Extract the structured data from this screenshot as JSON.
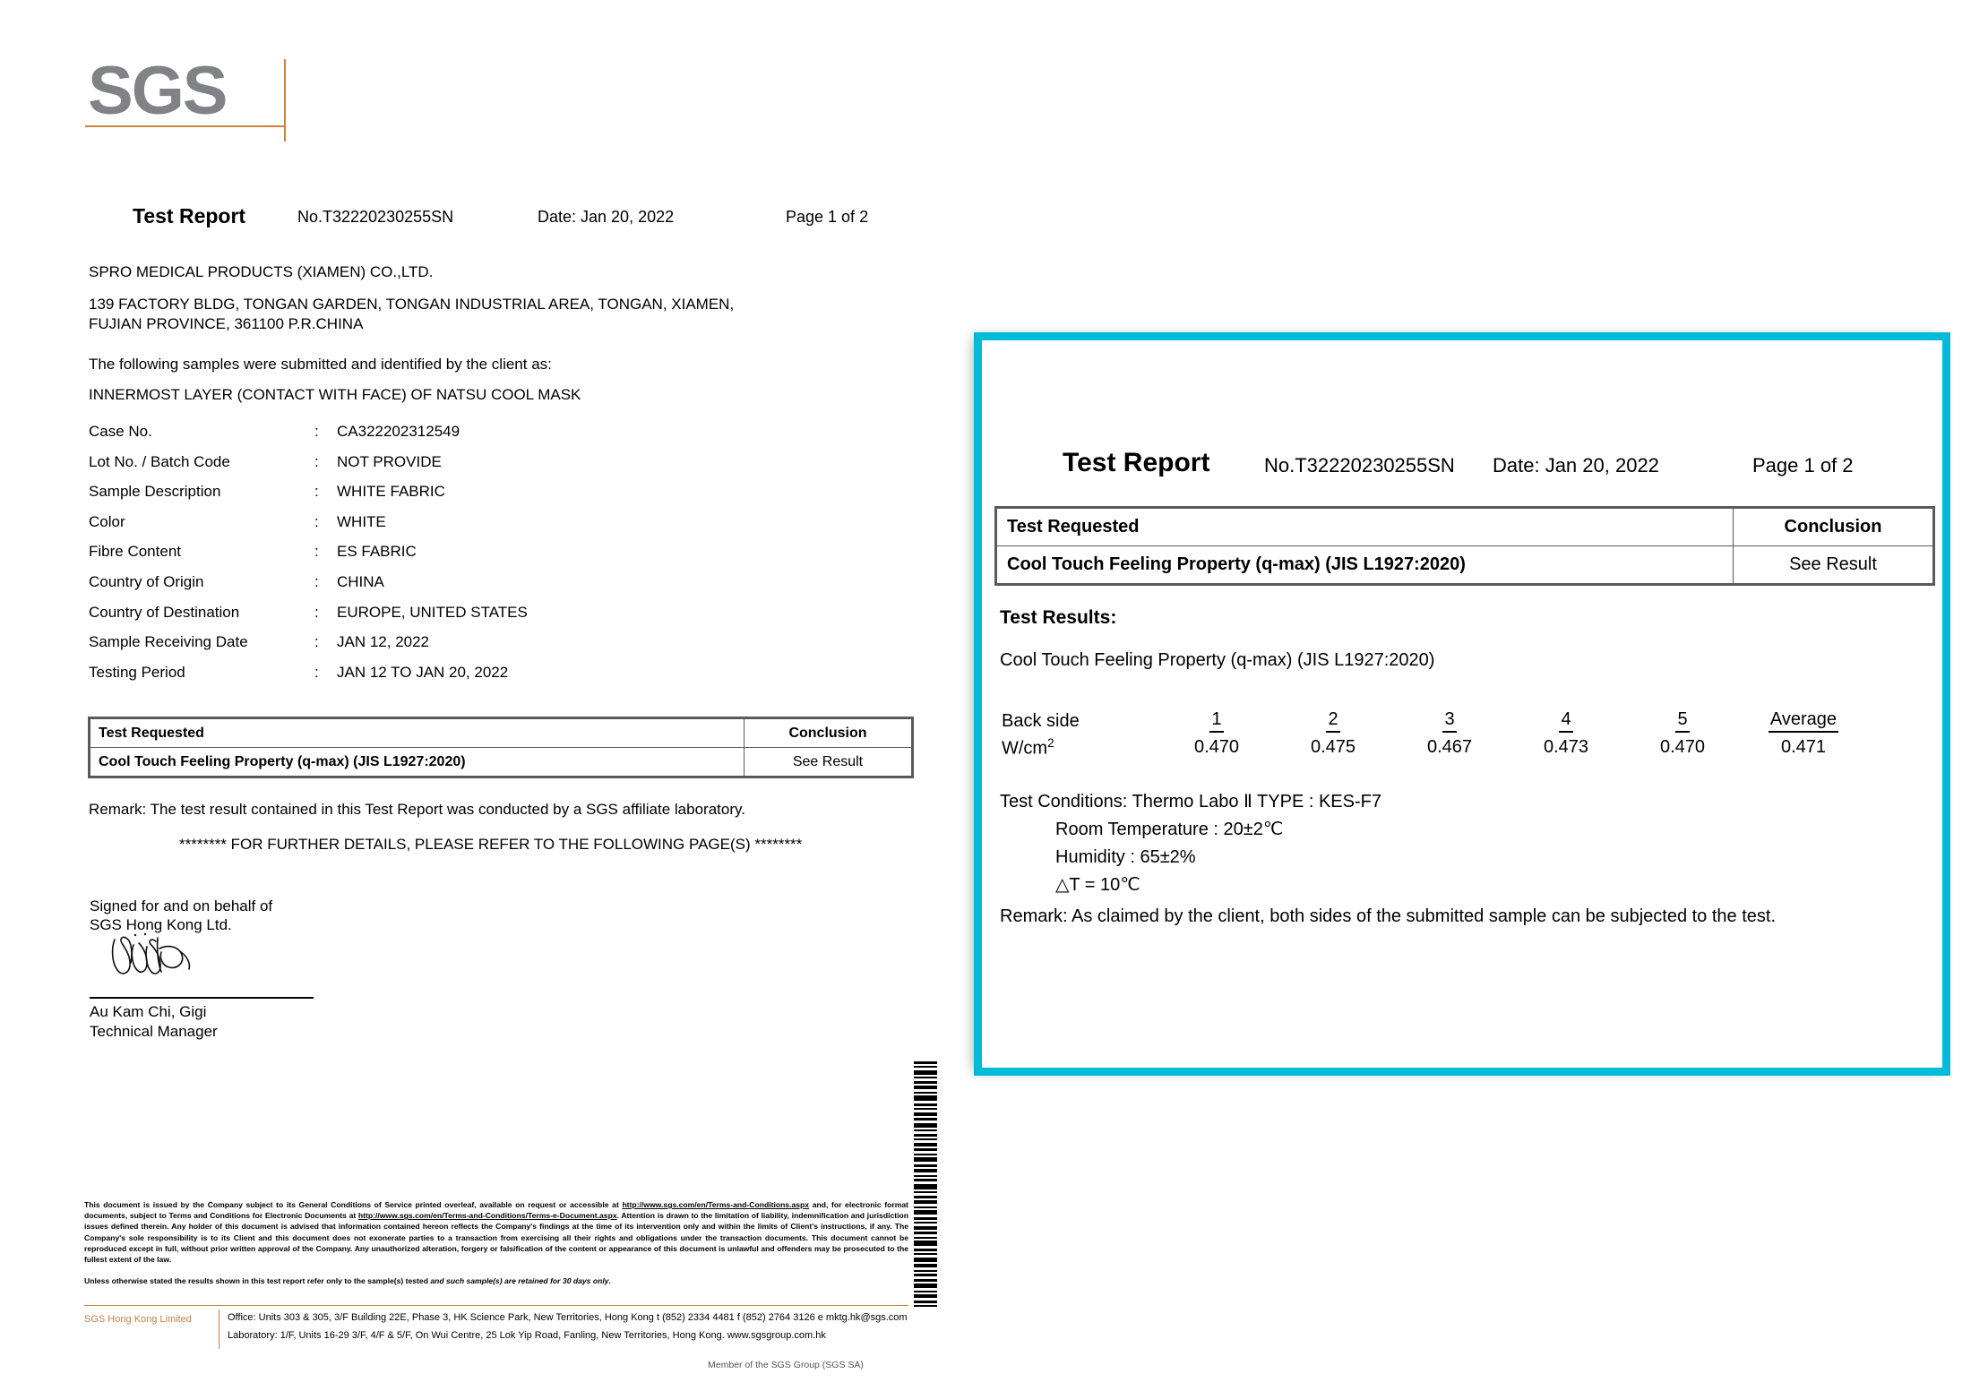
{
  "document": {
    "logo_text": "SGS",
    "header": {
      "title": "Test Report",
      "report_no": "No.T32220230255SN",
      "date": "Date:  Jan 20, 2022",
      "page": "Page 1 of  2"
    },
    "client": {
      "name": "SPRO MEDICAL PRODUCTS (XIAMEN) CO.,LTD.",
      "address_line1": "139 FACTORY BLDG, TONGAN GARDEN, TONGAN INDUSTRIAL AREA, TONGAN, XIAMEN,",
      "address_line2": "FUJIAN PROVINCE, 361100 P.R.CHINA"
    },
    "intro_line": "The following samples were submitted and identified by the client as:",
    "sample_line": "INNERMOST LAYER (CONTACT WITH FACE) OF NATSU COOL MASK",
    "fields": [
      {
        "label": "Case No.",
        "colon": ":",
        "value": "CA322202312549"
      },
      {
        "label": "Lot No. / Batch Code",
        "colon": ":",
        "value": "NOT PROVIDE"
      },
      {
        "label": "Sample Description",
        "colon": ":",
        "value": "WHITE FABRIC"
      },
      {
        "label": "Color",
        "colon": ":",
        "value": "WHITE"
      },
      {
        "label": "Fibre Content",
        "colon": ":",
        "value": "ES FABRIC"
      },
      {
        "label": "Country of Origin",
        "colon": ":",
        "value": "CHINA"
      },
      {
        "label": "Country of Destination",
        "colon": ":",
        "value": "EUROPE, UNITED STATES"
      },
      {
        "label": "Sample Receiving Date",
        "colon": ":",
        "value": "JAN 12, 2022"
      },
      {
        "label": "Testing Period",
        "colon": ":",
        "value": "JAN 12 TO JAN 20, 2022"
      }
    ],
    "test_requested_table": {
      "col_test": "Test Requested",
      "col_conclusion": "Conclusion",
      "row_test": "Cool Touch Feeling Property (q-max) (JIS L1927:2020)",
      "row_conclusion": "See Result"
    },
    "remark": "Remark: The test result contained in this Test Report was conducted by a SGS affiliate laboratory.",
    "further_details": "******** FOR FURTHER DETAILS, PLEASE REFER TO THE FOLLOWING PAGE(S) ********",
    "signature": {
      "line1": "Signed for and on behalf of",
      "line2": "SGS Hong Kong Ltd.",
      "name": "Au Kam Chi, Gigi",
      "title": "Technical Manager"
    },
    "footer": {
      "legal_part1": "This document is issued by the Company subject to its General Conditions of Service printed overleaf, available on request or accessible at ",
      "legal_url1": "http://www.sgs.com/en/Terms-and-Conditions.aspx",
      "legal_part2": " and, for electronic format documents, subject to Terms and Conditions for Electronic Documents at ",
      "legal_url2": "http://www.sgs.com/en/Terms-and-Conditions/Terms-e-Document.aspx",
      "legal_part3": ". Attention is drawn to the limitation of liability, indemnification and jurisdiction issues defined therein. Any holder of this document is advised that information contained hereon reflects the Company's findings at the time of its intervention only and within the limits of Client's instructions, if any. The Company's sole responsibility is to its Client and this document does not exonerate parties to a transaction from exercising all their rights and obligations under the transaction documents. This document cannot be reproduced except in full, without prior written approval of the Company. Any unauthorized alteration, forgery or falsification of the content or appearance of this document is unlawful and offenders may be prosecuted to the fullest extent of the law.",
      "retain_part1": "Unless otherwise stated the results shown in this test report refer only to the sample(s) tested ",
      "retain_italic": "and such sample(s) are retained for 30 days only",
      "retain_part2": ".",
      "company": "SGS Hong Kong Limited",
      "office_line": "Office: Units 303 & 305, 3/F Building 22E, Phase 3, HK Science Park, New Territories, Hong Kong  t (852) 2334 4481  f (852) 2764 3126  e mktg.hk@sgs.com",
      "lab_line": "Laboratory: 1/F, Units 16-29 3/F, 4/F & 5/F, On Wui Centre, 25 Lok Yip Road, Fanling, New Territories, Hong Kong.   www.sgsgroup.com.hk",
      "member": "Member of the SGS Group (SGS SA)"
    }
  },
  "zoom_panel": {
    "border_color": "#00BCD9",
    "header": {
      "title": "Test Report",
      "report_no": "No.T32220230255SN",
      "date": "Date:  Jan 20, 2022",
      "page": "Page 1 of  2"
    },
    "test_requested_table": {
      "col_test": "Test Requested",
      "col_conclusion": "Conclusion",
      "row_test": "Cool Touch Feeling Property (q-max) (JIS L1927:2020)",
      "row_conclusion": "See Result"
    },
    "results_heading": "Test Results:",
    "property_line": "Cool Touch Feeling Property (q-max) (JIS L1927:2020)",
    "results_table": {
      "row_label_1": "Back side",
      "row_label_2": "W/cm",
      "row_label_2_sup": "2",
      "headers": [
        "1",
        "2",
        "3",
        "4",
        "5"
      ],
      "average_header": "Average",
      "values": [
        "0.470",
        "0.475",
        "0.467",
        "0.473",
        "0.470"
      ],
      "average_value": "0.471"
    },
    "conditions": {
      "line1": "Test Conditions: Thermo Labo Ⅱ TYPE : KES-F7",
      "line2": "Room Temperature : 20±2℃",
      "line3": "Humidity : 65±2%",
      "line4": "△T = 10℃"
    },
    "remark": "Remark: As claimed by the client, both sides of the submitted sample can be subjected to the test."
  },
  "chart_data": {
    "type": "table",
    "title": "Cool Touch Feeling Property (q-max) (JIS L1927:2020)",
    "ylabel": "W/cm2",
    "categories": [
      "1",
      "2",
      "3",
      "4",
      "5",
      "Average"
    ],
    "series": [
      {
        "name": "Back side",
        "values": [
          0.47,
          0.475,
          0.467,
          0.473,
          0.47,
          0.471
        ]
      }
    ]
  }
}
